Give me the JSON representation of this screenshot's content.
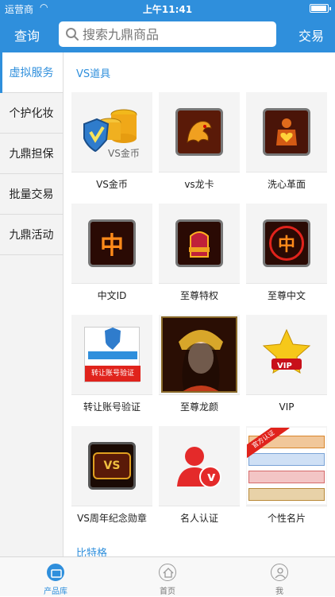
{
  "status_bar": {
    "carrier": "运营商",
    "time": "上午11:41"
  },
  "nav": {
    "left_label": "查询",
    "search_placeholder": "搜索九鼎商品",
    "right_label": "交易"
  },
  "sidebar": {
    "items": [
      {
        "label": "虚拟服务"
      },
      {
        "label": "个护化妆"
      },
      {
        "label": "九鼎担保"
      },
      {
        "label": "批量交易"
      },
      {
        "label": "九鼎活动"
      }
    ]
  },
  "content": {
    "section_title": "VS道具",
    "next_section_title": "比特格",
    "items": [
      {
        "name": "VS金币",
        "thumb_text": "VS金币",
        "icon": "vs-gold-coins-icon"
      },
      {
        "name": "vs龙卡",
        "icon": "dragon-card-icon"
      },
      {
        "name": "洗心革面",
        "icon": "heart-warrior-icon"
      },
      {
        "name": "中文ID",
        "thumb_text": "中",
        "icon": "chinese-id-icon"
      },
      {
        "name": "至尊特权",
        "icon": "throne-icon"
      },
      {
        "name": "至尊中文",
        "thumb_text": "中",
        "icon": "supreme-chinese-icon"
      },
      {
        "name": "转让账号验证",
        "thumb_text": "转让账号验证",
        "icon": "account-transfer-icon"
      },
      {
        "name": "至尊龙颜",
        "icon": "empress-portrait-icon"
      },
      {
        "name": "VIP",
        "thumb_text": "VIP",
        "icon": "vip-crown-icon"
      },
      {
        "name": "VS周年纪念勋章",
        "thumb_text": "VS",
        "icon": "anniversary-medal-icon"
      },
      {
        "name": "名人认证",
        "thumb_text": "v",
        "icon": "celebrity-verify-icon"
      },
      {
        "name": "个性名片",
        "thumb_text": "官方认证",
        "icon": "name-card-icon"
      }
    ]
  },
  "tabbar": {
    "tabs": [
      {
        "label": "产品库",
        "active": true
      },
      {
        "label": "首页",
        "active": false
      },
      {
        "label": "我",
        "active": false
      }
    ]
  },
  "colors": {
    "accent": "#2f8fdc",
    "sidebar_bg": "#f3f3f3"
  }
}
